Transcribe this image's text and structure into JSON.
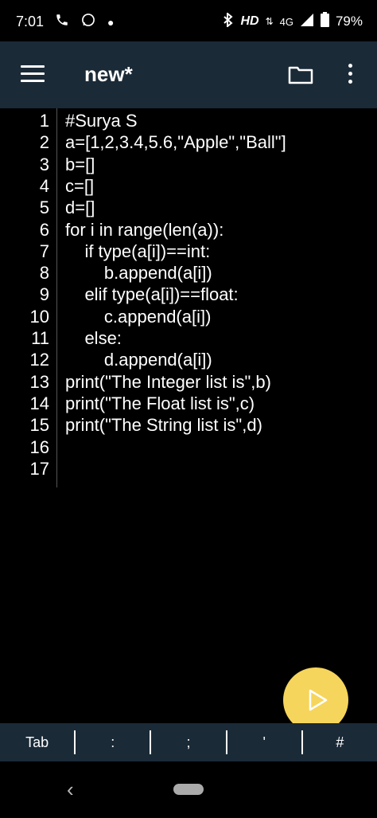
{
  "status_bar": {
    "time": "7:01",
    "network": "HD",
    "signal_type": "4G",
    "battery": "79%"
  },
  "app_bar": {
    "title": "new*"
  },
  "editor": {
    "lines": [
      {
        "num": "1",
        "text": "#Surya S"
      },
      {
        "num": "2",
        "text": "a=[1,2,3.4,5.6,\"Apple\",\"Ball\"]"
      },
      {
        "num": "3",
        "text": "b=[]"
      },
      {
        "num": "4",
        "text": "c=[]"
      },
      {
        "num": "5",
        "text": "d=[]"
      },
      {
        "num": "6",
        "text": "for i in range(len(a)):"
      },
      {
        "num": "7",
        "text": "    if type(a[i])==int:"
      },
      {
        "num": "8",
        "text": "        b.append(a[i])"
      },
      {
        "num": "9",
        "text": "    elif type(a[i])==float:"
      },
      {
        "num": "10",
        "text": "        c.append(a[i])"
      },
      {
        "num": "11",
        "text": "    else:"
      },
      {
        "num": "12",
        "text": "        d.append(a[i])"
      },
      {
        "num": "13",
        "text": "print(\"The Integer list is\",b)"
      },
      {
        "num": "14",
        "text": "print(\"The Float list is\",c)"
      },
      {
        "num": "15",
        "text": "print(\"The String list is\",d)"
      },
      {
        "num": "16",
        "text": ""
      },
      {
        "num": "17",
        "text": ""
      }
    ]
  },
  "shortcuts": [
    "Tab",
    ":",
    ";",
    "'",
    "#"
  ],
  "colors": {
    "app_bar": "#1b2a37",
    "run_button": "#f6d55c",
    "background": "#000000"
  },
  "icons": [
    "menu-icon",
    "folder-icon",
    "more-vert-icon",
    "play-icon",
    "back-icon",
    "phone-icon",
    "whatsapp-icon",
    "bluetooth-icon",
    "signal-icon",
    "battery-icon"
  ]
}
